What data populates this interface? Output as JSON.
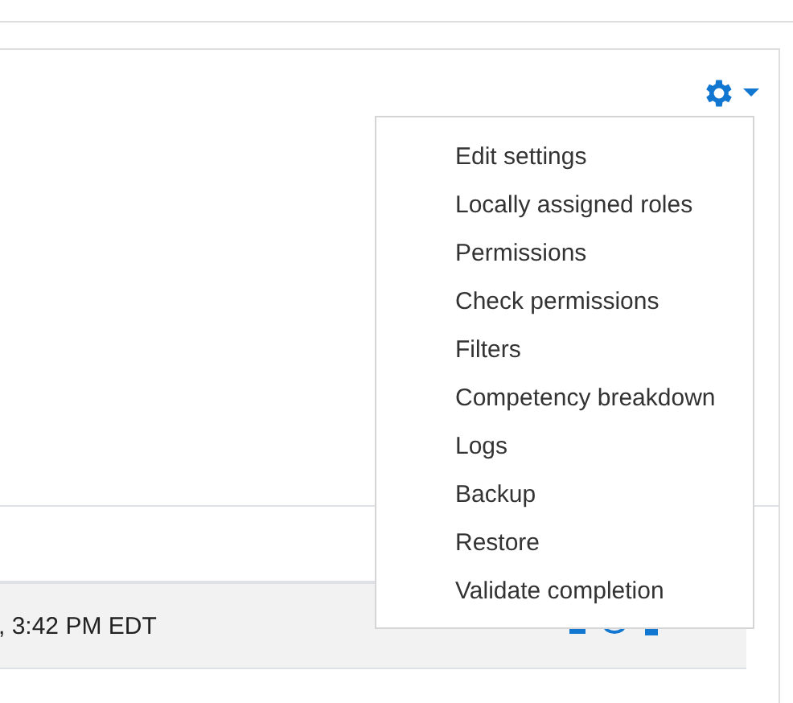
{
  "menu": {
    "items": [
      {
        "label": "Edit settings"
      },
      {
        "label": "Locally assigned roles"
      },
      {
        "label": "Permissions"
      },
      {
        "label": "Check permissions"
      },
      {
        "label": "Filters"
      },
      {
        "label": "Competency breakdown"
      },
      {
        "label": "Logs"
      },
      {
        "label": "Backup"
      },
      {
        "label": "Restore"
      },
      {
        "label": "Validate completion"
      }
    ]
  },
  "table": {
    "rows": [
      {
        "column_1": ", 3:42 PM EDT"
      }
    ]
  }
}
